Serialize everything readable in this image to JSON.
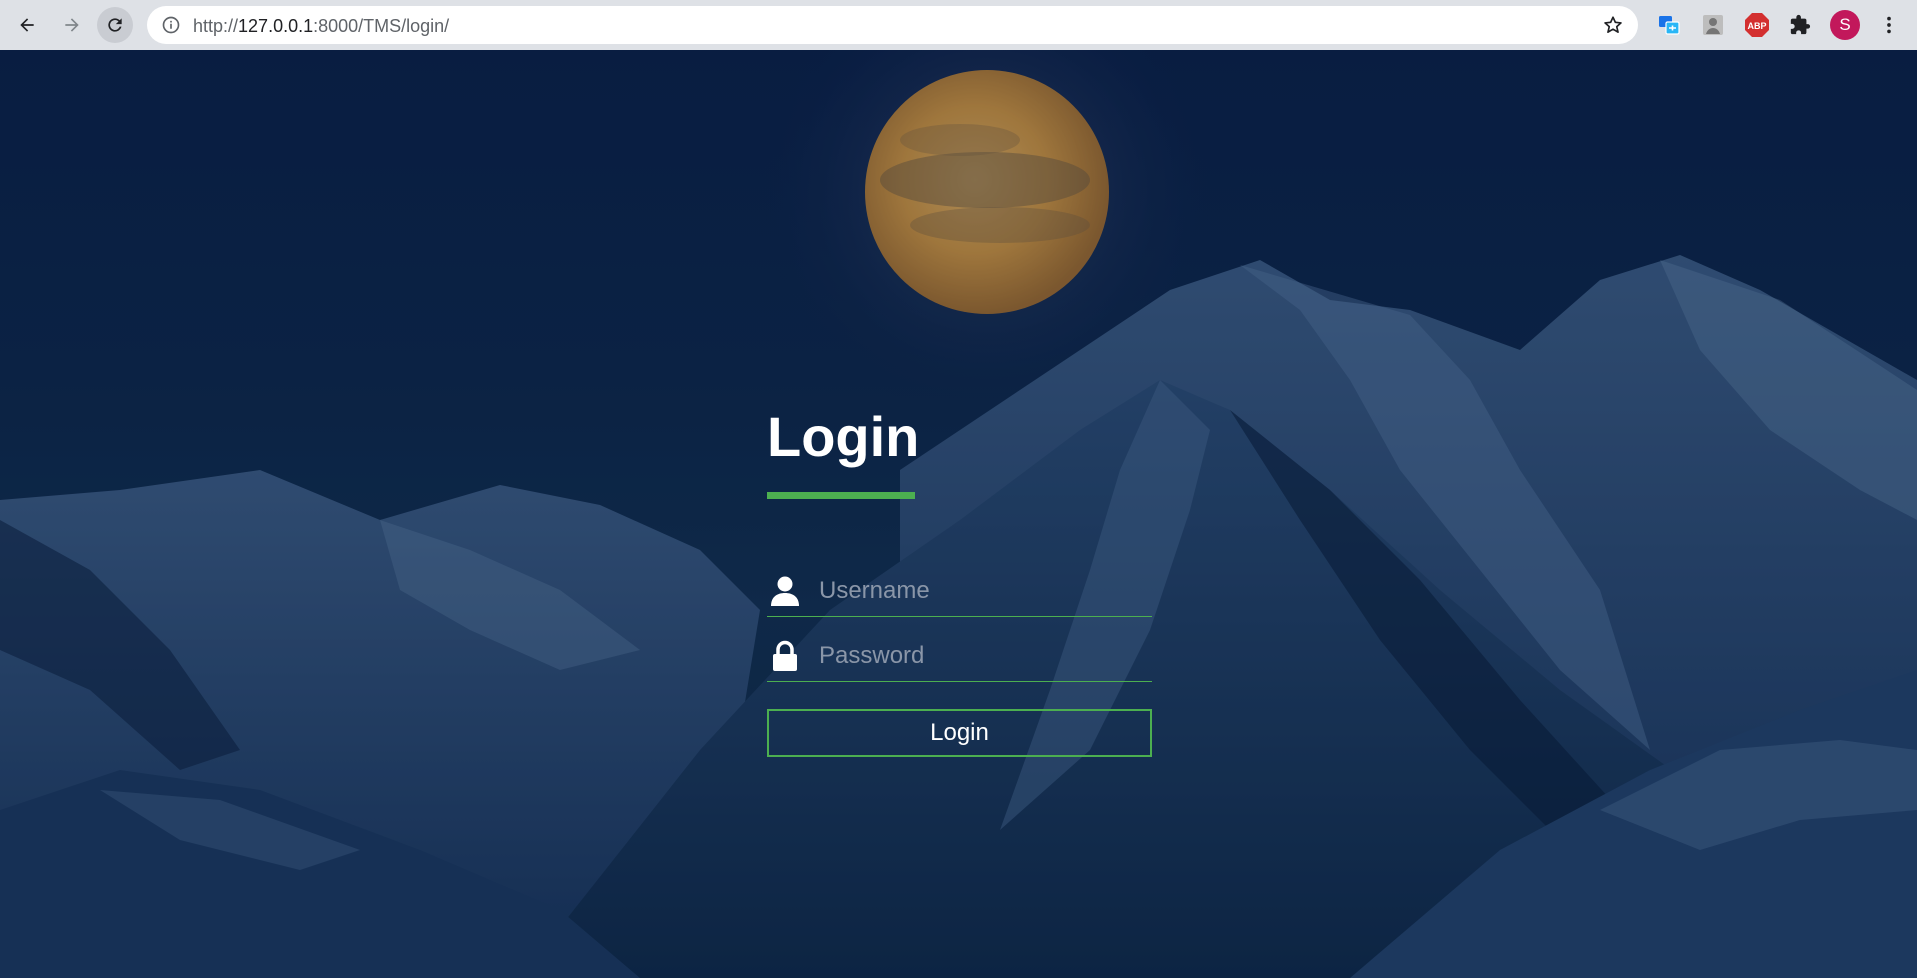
{
  "browser": {
    "url_prefix": "http://",
    "url_host": "127.0.0.1",
    "url_path": ":8000/TMS/login/",
    "abp_label": "ABP",
    "avatar_letter": "S"
  },
  "login": {
    "title": "Login",
    "username_placeholder": "Username",
    "password_placeholder": "Password",
    "button_label": "Login"
  },
  "colors": {
    "accent": "#4caf50",
    "sky": "#0a1f45",
    "moon": "#e0a74a",
    "avatar": "#c2185b"
  },
  "icons": {
    "back": "arrow-left-icon",
    "forward": "arrow-right-icon",
    "reload": "reload-icon",
    "info": "info-icon",
    "star": "star-icon",
    "translate": "translate-extension-icon",
    "person": "person-extension-icon",
    "abp": "adblock-plus-icon",
    "puzzle": "extensions-puzzle-icon",
    "menu": "more-vertical-icon",
    "user": "user-icon",
    "lock": "lock-icon"
  }
}
